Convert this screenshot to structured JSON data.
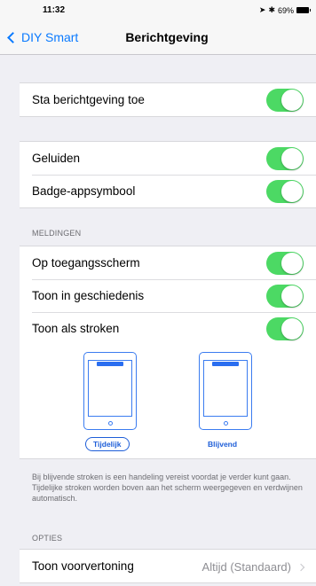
{
  "status": {
    "time": "11:32",
    "battery": "69%"
  },
  "nav": {
    "back_label": "DIY Smart",
    "title": "Berichtgeving"
  },
  "allow": {
    "label": "Sta berichtgeving toe",
    "on": true
  },
  "sounds_group": [
    {
      "label": "Geluiden",
      "on": true
    },
    {
      "label": "Badge-appsymbool",
      "on": true
    }
  ],
  "alerts_header": "MELDINGEN",
  "alerts_group": [
    {
      "label": "Op toegangsscherm",
      "on": true
    },
    {
      "label": "Toon in geschiedenis",
      "on": true
    },
    {
      "label": "Toon als stroken",
      "on": true
    }
  ],
  "banner_styles": {
    "temporary": "Tijdelijk",
    "persistent": "Blijvend",
    "selected": "temporary"
  },
  "footnote": {
    "line1": "Bij blijvende stroken is een handeling vereist voordat je verder kunt gaan.",
    "line2": "Tijdelijke stroken worden boven aan het scherm weergegeven en verdwijnen automatisch."
  },
  "options_header": "OPTIES",
  "preview": {
    "label": "Toon voorvertoning",
    "value": "Altijd (Standaard)"
  },
  "colors": {
    "accent": "#0a7aff",
    "toggle_on": "#4cd964"
  }
}
